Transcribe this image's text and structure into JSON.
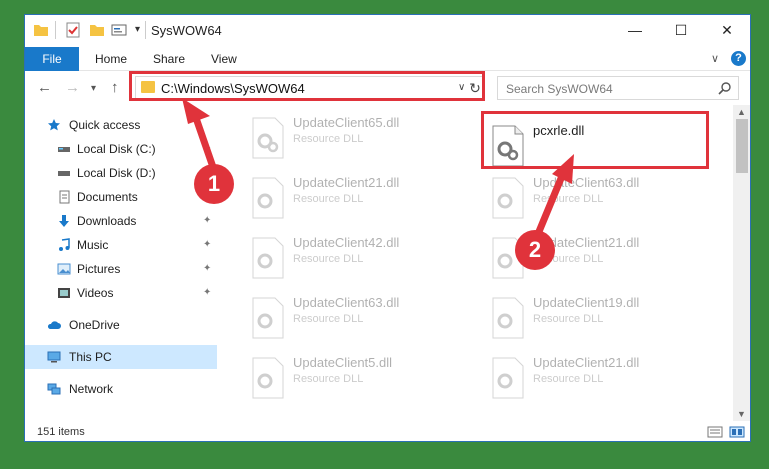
{
  "window": {
    "title": "SysWOW64",
    "controls": {
      "minimize": "—",
      "maximize": "☐",
      "close": "✕"
    }
  },
  "ribbon": {
    "tabs": [
      "File",
      "Home",
      "Share",
      "View"
    ],
    "help": "?"
  },
  "nav": {
    "address": "C:\\Windows\\SysWOW64",
    "search_placeholder": "Search SysWOW64"
  },
  "sidebar": {
    "items": [
      {
        "label": "Quick access",
        "icon": "star-icon"
      },
      {
        "label": "Local Disk (C:)",
        "icon": "drive-icon"
      },
      {
        "label": "Local Disk (D:)",
        "icon": "drive-icon"
      },
      {
        "label": "Documents",
        "icon": "documents-icon"
      },
      {
        "label": "Downloads",
        "icon": "downloads-icon"
      },
      {
        "label": "Music",
        "icon": "music-icon"
      },
      {
        "label": "Pictures",
        "icon": "pictures-icon"
      },
      {
        "label": "Videos",
        "icon": "videos-icon"
      },
      {
        "label": "OneDrive",
        "icon": "cloud-icon"
      },
      {
        "label": "This PC",
        "icon": "computer-icon",
        "selected": true
      },
      {
        "label": "Network",
        "icon": "network-icon"
      }
    ]
  },
  "files": [
    {
      "name": "UpdateClient65.dll",
      "type": "Resource DLL"
    },
    {
      "name": "pcxrle.dll",
      "type": "",
      "highlighted": true
    },
    {
      "name": "UpdateClient21.dll",
      "type": "Resource DLL"
    },
    {
      "name": "UpdateClient63.dll",
      "type": "Resource DLL"
    },
    {
      "name": "UpdateClient42.dll",
      "type": "Resource DLL"
    },
    {
      "name": "UpdateClient21.dll",
      "type": "Resource DLL"
    },
    {
      "name": "UpdateClient63.dll",
      "type": "Resource DLL"
    },
    {
      "name": "UpdateClient19.dll",
      "type": "Resource DLL"
    },
    {
      "name": "UpdateClient5.dll",
      "type": "Resource DLL"
    },
    {
      "name": "UpdateClient21.dll",
      "type": "Resource DLL"
    }
  ],
  "status": {
    "item_count": "151 items"
  },
  "annotations": {
    "step1": "1",
    "step2": "2",
    "color": "#e0333b"
  }
}
